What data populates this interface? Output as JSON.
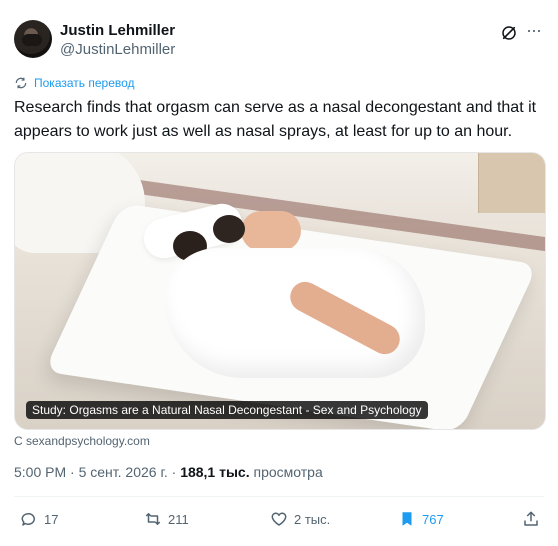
{
  "author": {
    "name": "Justin Lehmiller",
    "handle": "@JustinLehmiller"
  },
  "translate_label": "Показать перевод",
  "tweet_text": "Research finds that orgasm can serve as a nasal decongestant and that it appears to work just as well as nasal sprays, at least for up to an hour.",
  "media": {
    "caption": "Study: Orgasms are a Natural Nasal Decongestant - Sex and Psychology"
  },
  "source": "С sexandpsychology.com",
  "meta": {
    "time": "5:00 PM · 5 сент. 2026 г. · ",
    "views": "188,1 тыс.",
    "views_label": " просмотра"
  },
  "actions": {
    "replies": "17",
    "retweets": "211",
    "likes": "2 тыс.",
    "bookmarks": "767"
  },
  "colors": {
    "accent": "#1d9bf0",
    "secondary_text": "#536471"
  },
  "icons": [
    "grok-icon",
    "more-icon",
    "translate-icon",
    "reply-icon",
    "retweet-icon",
    "like-icon",
    "bookmark-icon",
    "share-icon"
  ]
}
